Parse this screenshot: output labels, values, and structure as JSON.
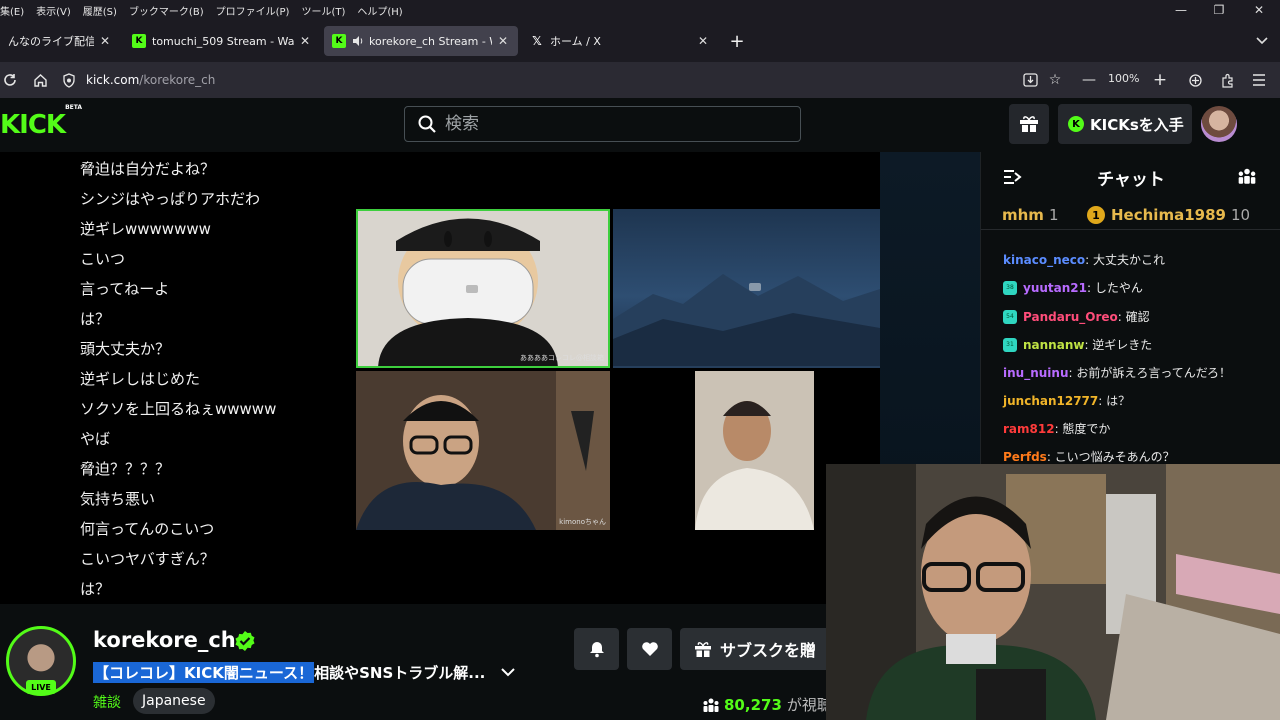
{
  "browser": {
    "menu": [
      "んなのライブ配信！",
      "表示(V)",
      "履歴(S)",
      "ブックマーク(B)",
      "プロファイル(P)",
      "ツール(T)",
      "ヘルプ(H)"
    ],
    "menu_edit": "集(E)",
    "tabs": [
      {
        "label": "んなのライブ配信！",
        "icon": "partial"
      },
      {
        "label": "tomuchi_509 Stream - Watch Live on Kick",
        "icon": "kick-icon"
      },
      {
        "label": "korekore_ch Stream - Watch Live on Kick",
        "icon": "kick-icon",
        "active": true
      },
      {
        "label": "ホーム / X",
        "icon": "x-icon"
      }
    ],
    "url_host": "kick.com",
    "url_path": "/korekore_ch",
    "zoom": "100%"
  },
  "kick": {
    "logo": "KICK",
    "logo_badge": "BETA",
    "search_placeholder": "検索",
    "get_kicks": "KICKsを入手"
  },
  "player": {
    "comments": [
      "脅迫は自分だよね？",
      "シンジはやっぱりアホだわ",
      "逆ギレwwwwwww",
      "こいつ",
      "言ってねーよ",
      "は？",
      "頭大丈夫か？",
      "逆ギレしはじめた",
      "ソクソを上回るねぇwwwww",
      "やば",
      "脅迫？？？？",
      "気持ち悪い",
      "何言ってんのこいつ",
      "こいつヤバすぎん？",
      "は？"
    ],
    "cam_labels": {
      "maskman": "ああああコレコレ@相談箱",
      "glasses": "kimonoちゃん"
    }
  },
  "stream": {
    "channel": "korekore_ch",
    "live": "LIVE",
    "title_highlight": "【コレコレ】KICK闇ニュース！",
    "title_rest": "相談やSNSトラブル解...",
    "category": "雑談",
    "language": "Japanese",
    "subscribe": "サブスクを贈",
    "viewers": "80,273",
    "viewers_label": "が視聴"
  },
  "chat": {
    "title": "チャット",
    "pinned": [
      {
        "name": "mhm",
        "count": "1"
      },
      {
        "rank": "1",
        "name": "Hechima1989",
        "count": "10"
      }
    ],
    "messages": [
      {
        "user": "kinaco_neco",
        "color": "#5b8cff",
        "text": ": 大丈夫かこれ",
        "badge": ""
      },
      {
        "user": "yuutan21",
        "color": "#b86bff",
        "text": ": したやん",
        "badge": "38"
      },
      {
        "user": "Pandaru_Oreo",
        "color": "#ff4d7a",
        "text": ": 確認",
        "badge": "54"
      },
      {
        "user": "nannanw",
        "color": "#c0e344",
        "text": ": 逆ギレきた",
        "badge": "31"
      },
      {
        "user": "inu_nuinu",
        "color": "#b86bff",
        "text": ": お前が訴えろ言ってんだろ！",
        "badge": ""
      },
      {
        "user": "junchan12777",
        "color": "#f0b429",
        "text": ": は？",
        "badge": ""
      },
      {
        "user": "ram812",
        "color": "#ff3b3b",
        "text": ": 態度でか",
        "badge": ""
      },
      {
        "user": "Perfds",
        "color": "#ff7a1a",
        "text": ": こいつ悩みそあんの？",
        "badge": ""
      }
    ]
  },
  "colors": {
    "kick_green": "#53fc18",
    "bg": "#0b0e0f",
    "panel": "#24272c"
  }
}
